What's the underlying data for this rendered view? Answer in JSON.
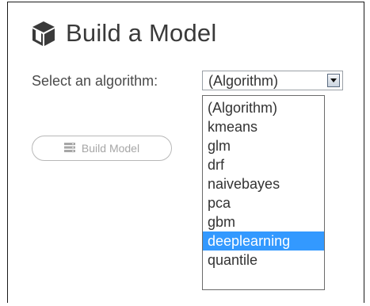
{
  "header": {
    "title": "Build a Model",
    "icon": "cube-icon"
  },
  "form": {
    "label": "Select an algorithm:",
    "select_value": "(Algorithm)",
    "options": [
      "(Algorithm)",
      "kmeans",
      "glm",
      "drf",
      "naivebayes",
      "pca",
      "gbm",
      "deeplearning",
      "quantile"
    ],
    "highlighted_option": "deeplearning"
  },
  "build_button": {
    "label": "Build Model",
    "icon": "server-icon",
    "enabled": false
  },
  "colors": {
    "highlight": "#3399ff",
    "text": "#3a3a3a",
    "disabled": "#a6a6a6"
  }
}
